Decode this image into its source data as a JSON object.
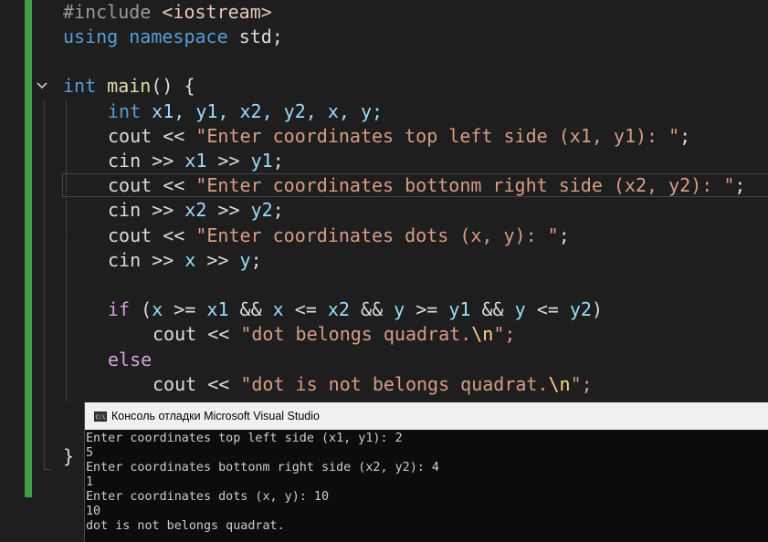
{
  "editor": {
    "t": {
      "hash": "#include ",
      "header": "<iostream>",
      "using": "using",
      "namespace": "namespace",
      "std": "std;",
      "int": "int",
      "main": "main",
      "paren_brace": "() {",
      "int_decl": "int",
      "vars": "x1, y1, x2, y2, x, y;",
      "cout": "cout",
      "cin": "cin",
      "out_op": " << ",
      "in_op": " >> ",
      "semi": ";",
      "str1": "\"Enter coordinates top left side (x1, y1): \"",
      "x1": "x1",
      "y1": "y1",
      "x2": "x2",
      "y2": "y2",
      "x": "x",
      "y": "y",
      "str2": "\"Enter coordinates bottonm right side (x2, y2): \"",
      "str3": "\"Enter coordinates dots (x, y): \"",
      "if": "if",
      "open": " (",
      "ge": " >= ",
      "le": " <= ",
      "and": " && ",
      "close": ")",
      "str4_a": "\"dot belongs quadrat.",
      "esc": "\\n",
      "quote_semi": "\";",
      "else": "else",
      "str5_a": "\"dot is not belongs quadrat.",
      "close_brace": "}",
      "comma": ", "
    }
  },
  "console": {
    "title": "Консоль отладки Microsoft Visual Studio",
    "icon_label": "C:\\",
    "lines": [
      "Enter coordinates top left side (x1, y1): 2",
      "5",
      "Enter coordinates bottonm right side (x2, y2): 4",
      "1",
      "Enter coordinates dots (x, y): 10",
      "10",
      "dot is not belongs quadrat."
    ]
  }
}
